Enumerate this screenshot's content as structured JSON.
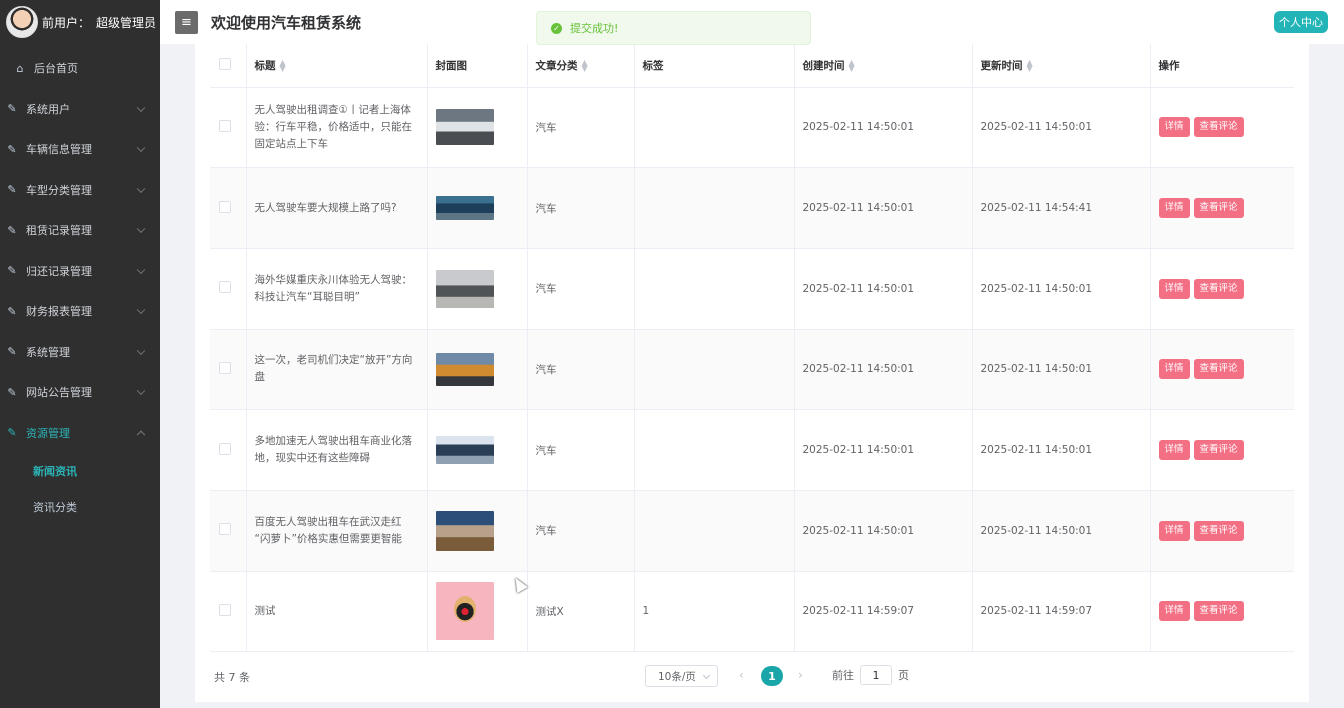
{
  "user": {
    "label": "前用户：",
    "role": "超级管理员"
  },
  "header": {
    "title": "欢迎使用汽车租赁系统",
    "personal_center": "个人中心"
  },
  "toast": {
    "message": "提交成功!"
  },
  "sidebar": {
    "home": "后台首页",
    "items": [
      {
        "label": "系统用户"
      },
      {
        "label": "车辆信息管理"
      },
      {
        "label": "车型分类管理"
      },
      {
        "label": "租赁记录管理"
      },
      {
        "label": "归还记录管理"
      },
      {
        "label": "财务报表管理"
      },
      {
        "label": "系统管理"
      },
      {
        "label": "网站公告管理"
      },
      {
        "label": "资源管理"
      }
    ],
    "subitems": [
      {
        "label": "新闻资讯",
        "active": true
      },
      {
        "label": "资讯分类",
        "active": false
      }
    ]
  },
  "table": {
    "headers": {
      "title": "标题",
      "cover": "封面图",
      "category": "文章分类",
      "tags": "标签",
      "created": "创建时间",
      "updated": "更新时间",
      "actions": "操作"
    },
    "rows": [
      {
        "title": "无人驾驶出租调查①丨记者上海体验：行车平稳，价格适中，只能在固定站点上下车",
        "category": "汽车",
        "tags": "",
        "created": "2025-02-11 14:50:01",
        "updated": "2025-02-11 14:50:01"
      },
      {
        "title": "无人驾驶车要大规模上路了吗?",
        "category": "汽车",
        "tags": "",
        "created": "2025-02-11 14:50:01",
        "updated": "2025-02-11 14:54:41"
      },
      {
        "title": "海外华媒重庆永川体验无人驾驶：科技让汽车“耳聪目明”",
        "category": "汽车",
        "tags": "",
        "created": "2025-02-11 14:50:01",
        "updated": "2025-02-11 14:50:01"
      },
      {
        "title": "这一次，老司机们决定“放开”方向盘",
        "category": "汽车",
        "tags": "",
        "created": "2025-02-11 14:50:01",
        "updated": "2025-02-11 14:50:01"
      },
      {
        "title": "多地加速无人驾驶出租车商业化落地，现实中还有这些障碍",
        "category": "汽车",
        "tags": "",
        "created": "2025-02-11 14:50:01",
        "updated": "2025-02-11 14:50:01"
      },
      {
        "title": "百度无人驾驶出租车在武汉走红 “闪萝卜”价格实惠但需要更智能",
        "category": "汽车",
        "tags": "",
        "created": "2025-02-11 14:50:01",
        "updated": "2025-02-11 14:50:01"
      },
      {
        "title": "测试",
        "category": "测试X",
        "tags": "1",
        "created": "2025-02-11 14:59:07",
        "updated": "2025-02-11 14:59:07"
      }
    ],
    "detail_label": "详情",
    "comments_label": "查看评论"
  },
  "pagination": {
    "total": "共 7 条",
    "page_size": "10条/页",
    "current_page": "1",
    "goto_prefix": "前往",
    "goto_value": "1",
    "goto_suffix": "页"
  }
}
